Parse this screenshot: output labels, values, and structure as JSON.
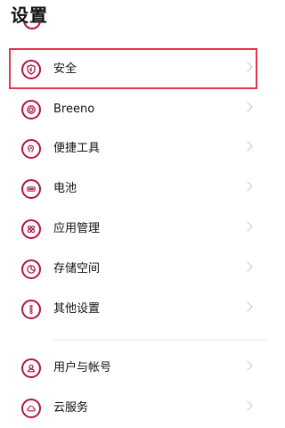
{
  "header": {
    "title": "设置"
  },
  "colors": {
    "accent": "#b0163f",
    "highlight": "#e4364f",
    "chevron": "#c6c6c6"
  },
  "items": [
    {
      "label": "安全",
      "icon": "shield-icon"
    },
    {
      "label": "Breeno",
      "icon": "breeno-icon"
    },
    {
      "label": "便捷工具",
      "icon": "tools-icon"
    },
    {
      "label": "电池",
      "icon": "battery-icon"
    },
    {
      "label": "应用管理",
      "icon": "apps-icon"
    },
    {
      "label": "存储空间",
      "icon": "storage-icon"
    },
    {
      "label": "其他设置",
      "icon": "more-icon"
    },
    {
      "label": "用户与帐号",
      "icon": "user-icon"
    },
    {
      "label": "云服务",
      "icon": "cloud-icon"
    }
  ]
}
